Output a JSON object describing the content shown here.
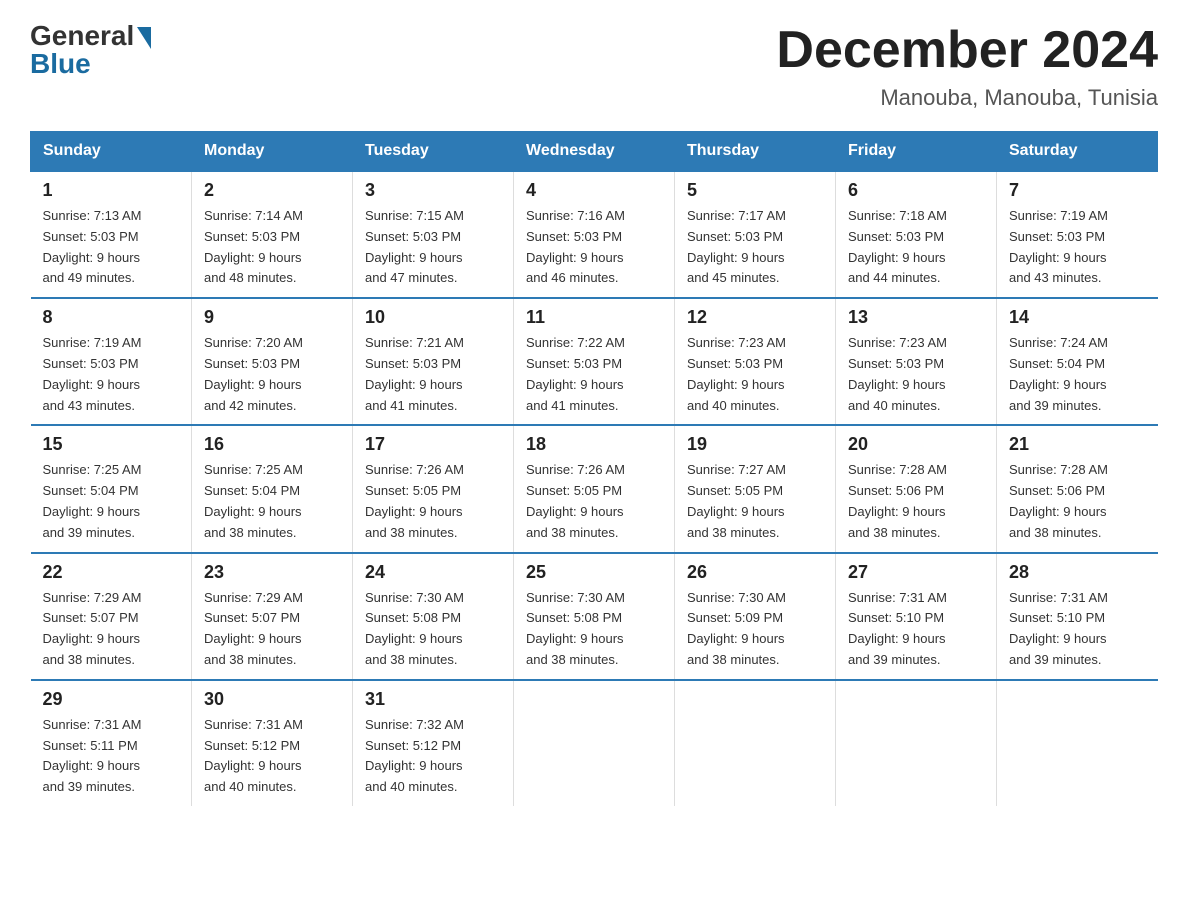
{
  "logo": {
    "general": "General",
    "blue": "Blue"
  },
  "title": "December 2024",
  "location": "Manouba, Manouba, Tunisia",
  "weekdays": [
    "Sunday",
    "Monday",
    "Tuesday",
    "Wednesday",
    "Thursday",
    "Friday",
    "Saturday"
  ],
  "weeks": [
    [
      {
        "day": 1,
        "sunrise": "7:13 AM",
        "sunset": "5:03 PM",
        "daylight": "9 hours and 49 minutes."
      },
      {
        "day": 2,
        "sunrise": "7:14 AM",
        "sunset": "5:03 PM",
        "daylight": "9 hours and 48 minutes."
      },
      {
        "day": 3,
        "sunrise": "7:15 AM",
        "sunset": "5:03 PM",
        "daylight": "9 hours and 47 minutes."
      },
      {
        "day": 4,
        "sunrise": "7:16 AM",
        "sunset": "5:03 PM",
        "daylight": "9 hours and 46 minutes."
      },
      {
        "day": 5,
        "sunrise": "7:17 AM",
        "sunset": "5:03 PM",
        "daylight": "9 hours and 45 minutes."
      },
      {
        "day": 6,
        "sunrise": "7:18 AM",
        "sunset": "5:03 PM",
        "daylight": "9 hours and 44 minutes."
      },
      {
        "day": 7,
        "sunrise": "7:19 AM",
        "sunset": "5:03 PM",
        "daylight": "9 hours and 43 minutes."
      }
    ],
    [
      {
        "day": 8,
        "sunrise": "7:19 AM",
        "sunset": "5:03 PM",
        "daylight": "9 hours and 43 minutes."
      },
      {
        "day": 9,
        "sunrise": "7:20 AM",
        "sunset": "5:03 PM",
        "daylight": "9 hours and 42 minutes."
      },
      {
        "day": 10,
        "sunrise": "7:21 AM",
        "sunset": "5:03 PM",
        "daylight": "9 hours and 41 minutes."
      },
      {
        "day": 11,
        "sunrise": "7:22 AM",
        "sunset": "5:03 PM",
        "daylight": "9 hours and 41 minutes."
      },
      {
        "day": 12,
        "sunrise": "7:23 AM",
        "sunset": "5:03 PM",
        "daylight": "9 hours and 40 minutes."
      },
      {
        "day": 13,
        "sunrise": "7:23 AM",
        "sunset": "5:03 PM",
        "daylight": "9 hours and 40 minutes."
      },
      {
        "day": 14,
        "sunrise": "7:24 AM",
        "sunset": "5:04 PM",
        "daylight": "9 hours and 39 minutes."
      }
    ],
    [
      {
        "day": 15,
        "sunrise": "7:25 AM",
        "sunset": "5:04 PM",
        "daylight": "9 hours and 39 minutes."
      },
      {
        "day": 16,
        "sunrise": "7:25 AM",
        "sunset": "5:04 PM",
        "daylight": "9 hours and 38 minutes."
      },
      {
        "day": 17,
        "sunrise": "7:26 AM",
        "sunset": "5:05 PM",
        "daylight": "9 hours and 38 minutes."
      },
      {
        "day": 18,
        "sunrise": "7:26 AM",
        "sunset": "5:05 PM",
        "daylight": "9 hours and 38 minutes."
      },
      {
        "day": 19,
        "sunrise": "7:27 AM",
        "sunset": "5:05 PM",
        "daylight": "9 hours and 38 minutes."
      },
      {
        "day": 20,
        "sunrise": "7:28 AM",
        "sunset": "5:06 PM",
        "daylight": "9 hours and 38 minutes."
      },
      {
        "day": 21,
        "sunrise": "7:28 AM",
        "sunset": "5:06 PM",
        "daylight": "9 hours and 38 minutes."
      }
    ],
    [
      {
        "day": 22,
        "sunrise": "7:29 AM",
        "sunset": "5:07 PM",
        "daylight": "9 hours and 38 minutes."
      },
      {
        "day": 23,
        "sunrise": "7:29 AM",
        "sunset": "5:07 PM",
        "daylight": "9 hours and 38 minutes."
      },
      {
        "day": 24,
        "sunrise": "7:30 AM",
        "sunset": "5:08 PM",
        "daylight": "9 hours and 38 minutes."
      },
      {
        "day": 25,
        "sunrise": "7:30 AM",
        "sunset": "5:08 PM",
        "daylight": "9 hours and 38 minutes."
      },
      {
        "day": 26,
        "sunrise": "7:30 AM",
        "sunset": "5:09 PM",
        "daylight": "9 hours and 38 minutes."
      },
      {
        "day": 27,
        "sunrise": "7:31 AM",
        "sunset": "5:10 PM",
        "daylight": "9 hours and 39 minutes."
      },
      {
        "day": 28,
        "sunrise": "7:31 AM",
        "sunset": "5:10 PM",
        "daylight": "9 hours and 39 minutes."
      }
    ],
    [
      {
        "day": 29,
        "sunrise": "7:31 AM",
        "sunset": "5:11 PM",
        "daylight": "9 hours and 39 minutes."
      },
      {
        "day": 30,
        "sunrise": "7:31 AM",
        "sunset": "5:12 PM",
        "daylight": "9 hours and 40 minutes."
      },
      {
        "day": 31,
        "sunrise": "7:32 AM",
        "sunset": "5:12 PM",
        "daylight": "9 hours and 40 minutes."
      },
      null,
      null,
      null,
      null
    ]
  ]
}
